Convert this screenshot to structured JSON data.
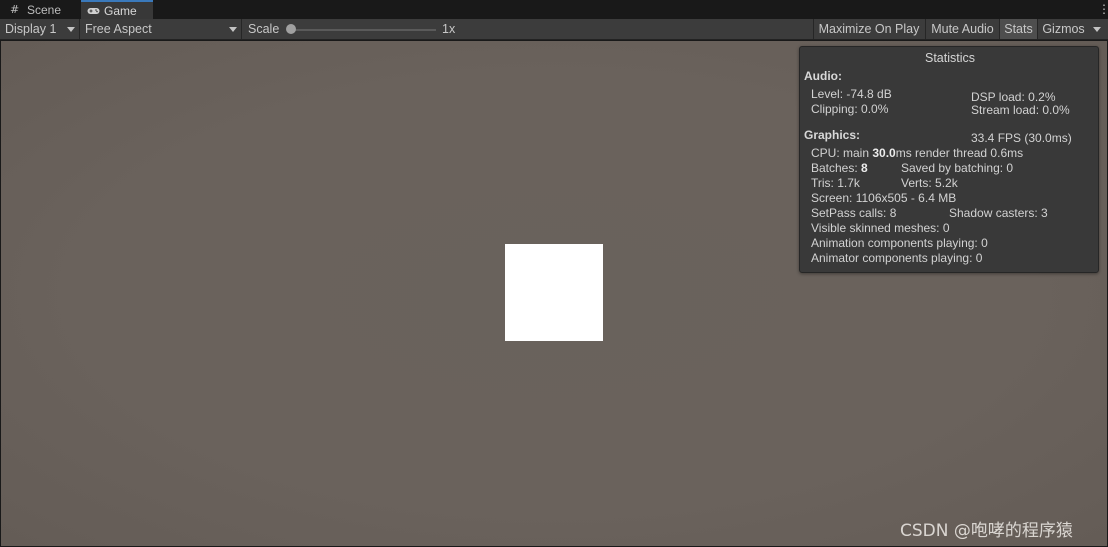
{
  "tabs": [
    {
      "label": "Scene",
      "icon": "grid-icon",
      "active": false
    },
    {
      "label": "Game",
      "icon": "gamepad-icon",
      "active": true
    }
  ],
  "toolbar": {
    "display": "Display 1",
    "aspect": "Free Aspect",
    "scale_label": "Scale",
    "scale_value": "1x",
    "scale_slider_fraction": 0.0,
    "maximize": "Maximize On Play",
    "mute": "Mute Audio",
    "stats": "Stats",
    "gizmos": "Gizmos"
  },
  "stats": {
    "title": "Statistics",
    "audio_header": "Audio:",
    "level": "Level: -74.8 dB",
    "dsp": "DSP load: 0.2%",
    "clipping": "Clipping: 0.0%",
    "stream": "Stream load: 0.0%",
    "graphics_header": "Graphics:",
    "fps": "33.4 FPS (30.0ms)",
    "cpu_prefix": "CPU: main ",
    "cpu_main": "30.0",
    "cpu_suffix": "ms  render thread 0.6ms",
    "batches_prefix": "Batches: ",
    "batches": "8",
    "saved_batching": "Saved by batching: 0",
    "tris": "Tris: 1.7k",
    "verts": "Verts: 5.2k",
    "screen": "Screen: 1106x505 - 6.4 MB",
    "setpass": "SetPass calls: 8",
    "shadow": "Shadow casters: 3",
    "skinned": "Visible skinned meshes: 0",
    "animation": "Animation components playing: 0",
    "animator": "Animator components playing: 0"
  },
  "watermark": "CSDN @咆哮的程序猿",
  "colors": {
    "accent": "#3a79bb",
    "game_background": "#69625c",
    "square": "#ffffff"
  }
}
